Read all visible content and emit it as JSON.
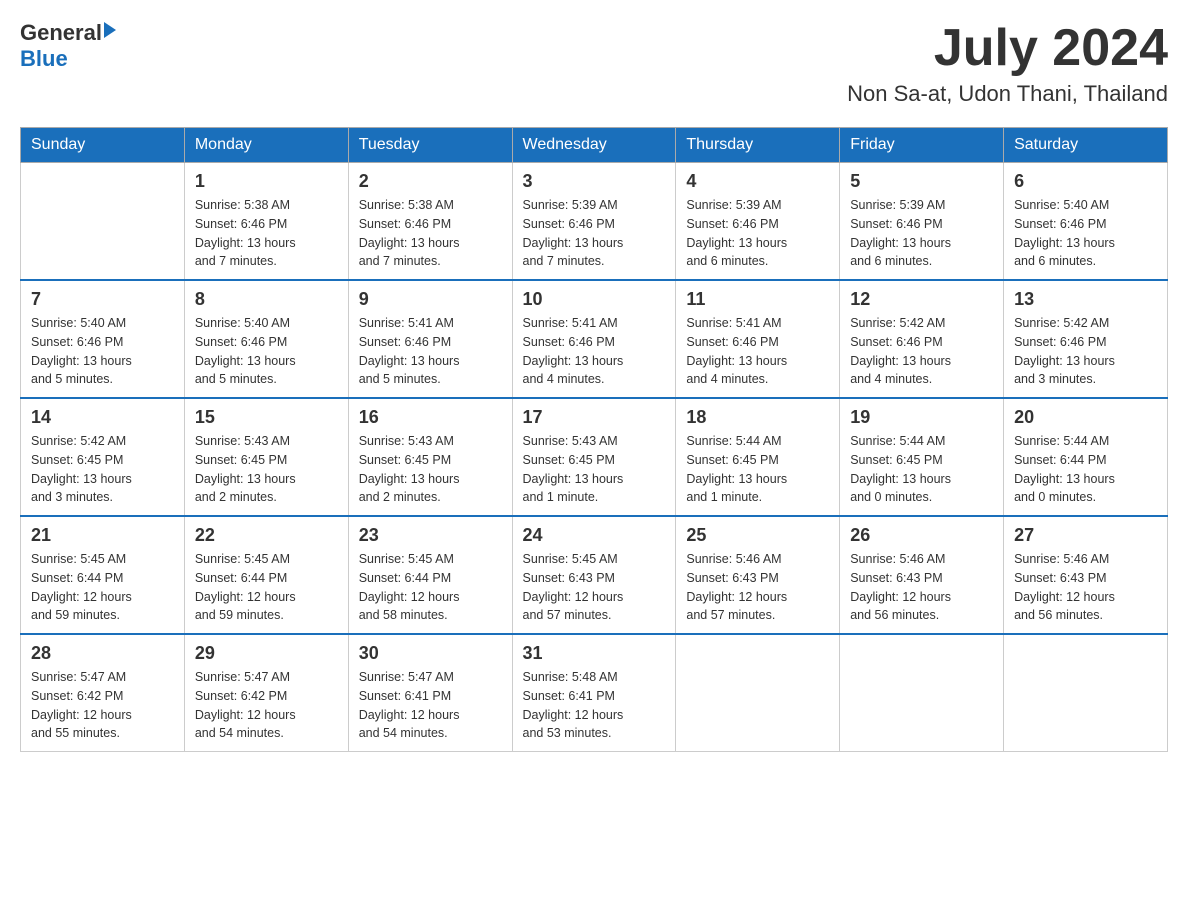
{
  "header": {
    "logo_general": "General",
    "logo_blue": "Blue",
    "month": "July 2024",
    "location": "Non Sa-at, Udon Thani, Thailand"
  },
  "weekdays": [
    "Sunday",
    "Monday",
    "Tuesday",
    "Wednesday",
    "Thursday",
    "Friday",
    "Saturday"
  ],
  "weeks": [
    {
      "days": [
        {
          "num": "",
          "info": ""
        },
        {
          "num": "1",
          "info": "Sunrise: 5:38 AM\nSunset: 6:46 PM\nDaylight: 13 hours\nand 7 minutes."
        },
        {
          "num": "2",
          "info": "Sunrise: 5:38 AM\nSunset: 6:46 PM\nDaylight: 13 hours\nand 7 minutes."
        },
        {
          "num": "3",
          "info": "Sunrise: 5:39 AM\nSunset: 6:46 PM\nDaylight: 13 hours\nand 7 minutes."
        },
        {
          "num": "4",
          "info": "Sunrise: 5:39 AM\nSunset: 6:46 PM\nDaylight: 13 hours\nand 6 minutes."
        },
        {
          "num": "5",
          "info": "Sunrise: 5:39 AM\nSunset: 6:46 PM\nDaylight: 13 hours\nand 6 minutes."
        },
        {
          "num": "6",
          "info": "Sunrise: 5:40 AM\nSunset: 6:46 PM\nDaylight: 13 hours\nand 6 minutes."
        }
      ]
    },
    {
      "days": [
        {
          "num": "7",
          "info": "Sunrise: 5:40 AM\nSunset: 6:46 PM\nDaylight: 13 hours\nand 5 minutes."
        },
        {
          "num": "8",
          "info": "Sunrise: 5:40 AM\nSunset: 6:46 PM\nDaylight: 13 hours\nand 5 minutes."
        },
        {
          "num": "9",
          "info": "Sunrise: 5:41 AM\nSunset: 6:46 PM\nDaylight: 13 hours\nand 5 minutes."
        },
        {
          "num": "10",
          "info": "Sunrise: 5:41 AM\nSunset: 6:46 PM\nDaylight: 13 hours\nand 4 minutes."
        },
        {
          "num": "11",
          "info": "Sunrise: 5:41 AM\nSunset: 6:46 PM\nDaylight: 13 hours\nand 4 minutes."
        },
        {
          "num": "12",
          "info": "Sunrise: 5:42 AM\nSunset: 6:46 PM\nDaylight: 13 hours\nand 4 minutes."
        },
        {
          "num": "13",
          "info": "Sunrise: 5:42 AM\nSunset: 6:46 PM\nDaylight: 13 hours\nand 3 minutes."
        }
      ]
    },
    {
      "days": [
        {
          "num": "14",
          "info": "Sunrise: 5:42 AM\nSunset: 6:45 PM\nDaylight: 13 hours\nand 3 minutes."
        },
        {
          "num": "15",
          "info": "Sunrise: 5:43 AM\nSunset: 6:45 PM\nDaylight: 13 hours\nand 2 minutes."
        },
        {
          "num": "16",
          "info": "Sunrise: 5:43 AM\nSunset: 6:45 PM\nDaylight: 13 hours\nand 2 minutes."
        },
        {
          "num": "17",
          "info": "Sunrise: 5:43 AM\nSunset: 6:45 PM\nDaylight: 13 hours\nand 1 minute."
        },
        {
          "num": "18",
          "info": "Sunrise: 5:44 AM\nSunset: 6:45 PM\nDaylight: 13 hours\nand 1 minute."
        },
        {
          "num": "19",
          "info": "Sunrise: 5:44 AM\nSunset: 6:45 PM\nDaylight: 13 hours\nand 0 minutes."
        },
        {
          "num": "20",
          "info": "Sunrise: 5:44 AM\nSunset: 6:44 PM\nDaylight: 13 hours\nand 0 minutes."
        }
      ]
    },
    {
      "days": [
        {
          "num": "21",
          "info": "Sunrise: 5:45 AM\nSunset: 6:44 PM\nDaylight: 12 hours\nand 59 minutes."
        },
        {
          "num": "22",
          "info": "Sunrise: 5:45 AM\nSunset: 6:44 PM\nDaylight: 12 hours\nand 59 minutes."
        },
        {
          "num": "23",
          "info": "Sunrise: 5:45 AM\nSunset: 6:44 PM\nDaylight: 12 hours\nand 58 minutes."
        },
        {
          "num": "24",
          "info": "Sunrise: 5:45 AM\nSunset: 6:43 PM\nDaylight: 12 hours\nand 57 minutes."
        },
        {
          "num": "25",
          "info": "Sunrise: 5:46 AM\nSunset: 6:43 PM\nDaylight: 12 hours\nand 57 minutes."
        },
        {
          "num": "26",
          "info": "Sunrise: 5:46 AM\nSunset: 6:43 PM\nDaylight: 12 hours\nand 56 minutes."
        },
        {
          "num": "27",
          "info": "Sunrise: 5:46 AM\nSunset: 6:43 PM\nDaylight: 12 hours\nand 56 minutes."
        }
      ]
    },
    {
      "days": [
        {
          "num": "28",
          "info": "Sunrise: 5:47 AM\nSunset: 6:42 PM\nDaylight: 12 hours\nand 55 minutes."
        },
        {
          "num": "29",
          "info": "Sunrise: 5:47 AM\nSunset: 6:42 PM\nDaylight: 12 hours\nand 54 minutes."
        },
        {
          "num": "30",
          "info": "Sunrise: 5:47 AM\nSunset: 6:41 PM\nDaylight: 12 hours\nand 54 minutes."
        },
        {
          "num": "31",
          "info": "Sunrise: 5:48 AM\nSunset: 6:41 PM\nDaylight: 12 hours\nand 53 minutes."
        },
        {
          "num": "",
          "info": ""
        },
        {
          "num": "",
          "info": ""
        },
        {
          "num": "",
          "info": ""
        }
      ]
    }
  ]
}
